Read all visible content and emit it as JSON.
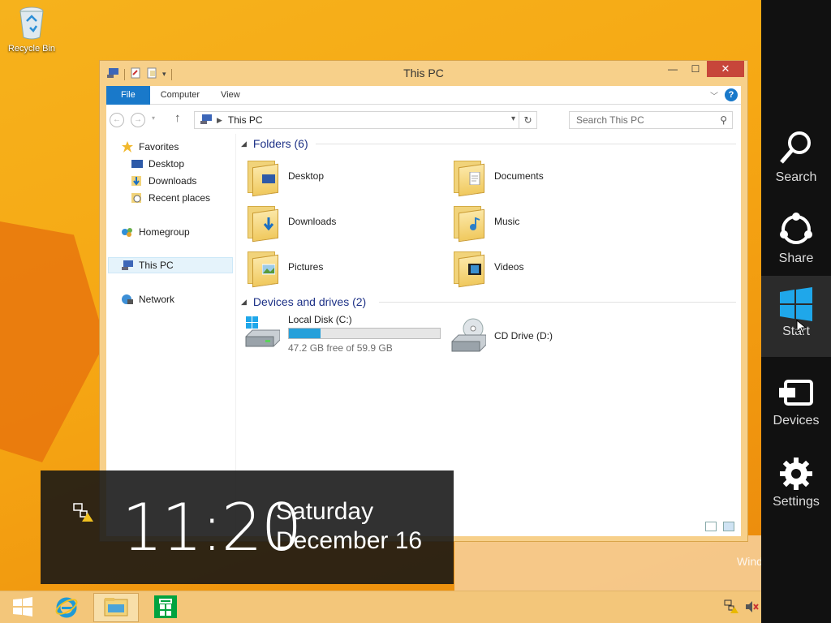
{
  "desktop": {
    "recycle_bin_label": "Recycle Bin",
    "watermark": "Wind"
  },
  "window": {
    "title": "This PC",
    "buttons": {
      "minimize": "—",
      "maximize": "☐",
      "close": "✕"
    },
    "ribbon_tabs": [
      "File",
      "Computer",
      "View"
    ],
    "address": {
      "location": "This PC",
      "search_placeholder": "Search This PC"
    },
    "nav": {
      "favorites": "Favorites",
      "favorites_items": [
        "Desktop",
        "Downloads",
        "Recent places"
      ],
      "homegroup": "Homegroup",
      "this_pc": "This PC",
      "network": "Network"
    },
    "folders_header": "Folders (6)",
    "folders": [
      "Desktop",
      "Documents",
      "Downloads",
      "Music",
      "Pictures",
      "Videos"
    ],
    "devices_header": "Devices and drives (2)",
    "drives": {
      "local_name": "Local Disk (C:)",
      "local_free": "47.2 GB free of 59.9 GB",
      "local_used_fraction": 0.212,
      "cd_name": "CD Drive (D:)"
    }
  },
  "charms": [
    "Search",
    "Share",
    "Start",
    "Devices",
    "Settings"
  ],
  "clock": {
    "time": "11:20",
    "day": "Saturday",
    "date": "December 16"
  },
  "colors": {
    "accent": "#1979ca",
    "charm_bar": "#111111",
    "desktop": "#f6a814",
    "start_logo": "#1fa7ea"
  }
}
